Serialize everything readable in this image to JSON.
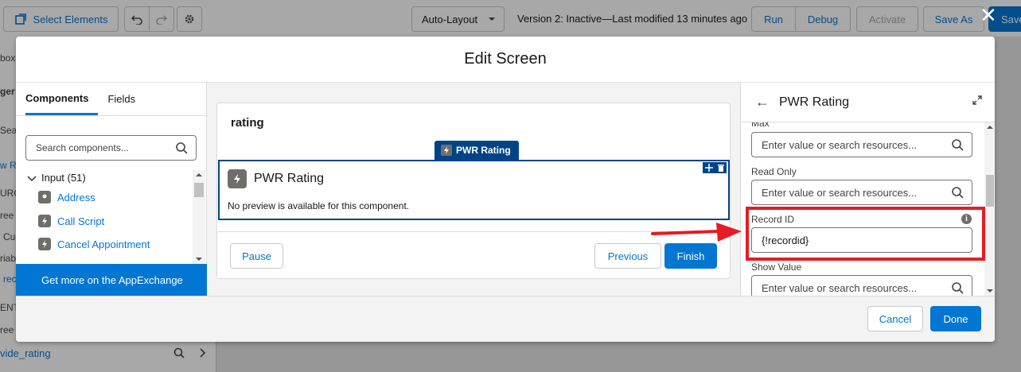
{
  "toolbar": {
    "select_elements": "Select Elements",
    "auto_layout": "Auto-Layout",
    "version_status": "Version 2: Inactive—Last modified 13 minutes ago",
    "run": "Run",
    "debug": "Debug",
    "activate": "Activate",
    "save_as": "Save As",
    "save": "Save"
  },
  "background_sidebar": {
    "fragments": [
      "box",
      "ger",
      "Sear",
      "w Re",
      "URC",
      "ree",
      "Cu",
      "riab",
      "rec",
      "ENT",
      "ree"
    ],
    "bottom_item": "vide_rating"
  },
  "modal": {
    "title": "Edit Screen",
    "components_panel": {
      "tabs": [
        "Components",
        "Fields"
      ],
      "search_placeholder": "Search components...",
      "group_label": "Input (51)",
      "items": [
        "Address",
        "Call Script",
        "Cancel Appointment"
      ],
      "appexchange": "Get more on the AppExchange"
    },
    "canvas": {
      "screen_title": "rating",
      "component_tag": "PWR Rating",
      "component_title": "PWR Rating",
      "component_note": "No preview is available for this component.",
      "pause": "Pause",
      "previous": "Previous",
      "finish": "Finish"
    },
    "properties": {
      "title": "PWR Rating",
      "fields": [
        {
          "label": "Max",
          "value": "",
          "placeholder": "Enter value or search resources..."
        },
        {
          "label": "Read Only",
          "value": "",
          "placeholder": "Enter value or search resources..."
        },
        {
          "label": "Record ID",
          "value": "{!recordid}",
          "placeholder": ""
        },
        {
          "label": "Show Value",
          "value": "",
          "placeholder": "Enter value or search resources..."
        }
      ]
    },
    "footer": {
      "cancel": "Cancel",
      "done": "Done"
    }
  },
  "colors": {
    "brand_blue": "#0176d3",
    "dark_blue": "#014486",
    "highlight_red": "#e51c23"
  }
}
